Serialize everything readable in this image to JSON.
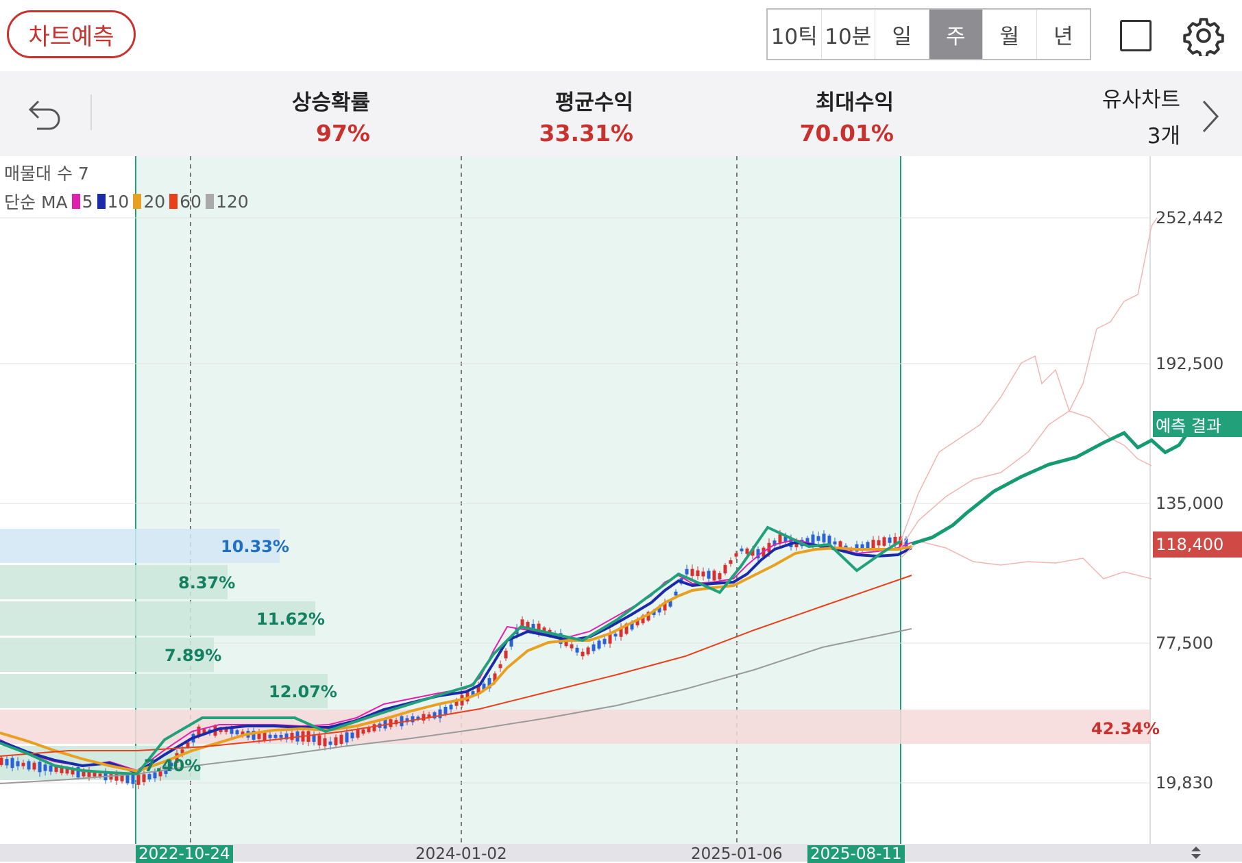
{
  "toolbar": {
    "predict_label": "차트예측",
    "periods": [
      "10틱",
      "10분",
      "일",
      "주",
      "월",
      "년"
    ],
    "active_period": "주"
  },
  "stats": {
    "rise_prob": {
      "label": "상승확률",
      "value": "97%"
    },
    "avg_return": {
      "label": "평균수익",
      "value": "33.31%"
    },
    "max_return": {
      "label": "최대수익",
      "value": "70.01%"
    },
    "similar": {
      "label": "유사차트",
      "value": "3개"
    }
  },
  "legend": {
    "volume_profile": "매물대 수 7",
    "ma_prefix": "단순 MA",
    "ma_periods": [
      {
        "period": "5",
        "color": "#e020b0"
      },
      {
        "period": "10",
        "color": "#1a2aa8"
      },
      {
        "period": "20",
        "color": "#e8a020"
      },
      {
        "period": "60",
        "color": "#e8401a"
      },
      {
        "period": "120",
        "color": "#aaaaaa"
      }
    ]
  },
  "chart_data": {
    "type": "line",
    "x_ticks": [
      "2022-10-24",
      "2024-01-02",
      "2025-01-06",
      "2025-08-11"
    ],
    "y_ticks": [
      "252,442",
      "192,500",
      "135,000",
      "77,500",
      "19,830"
    ],
    "current_price": "118,400",
    "prediction_label": "예측 결과",
    "volume_profile": [
      {
        "pct": "10.33%",
        "color": "#1f6fc4"
      },
      {
        "pct": "8.37%",
        "color": "#138060"
      },
      {
        "pct": "11.62%",
        "color": "#138060"
      },
      {
        "pct": "7.89%",
        "color": "#138060"
      },
      {
        "pct": "12.07%",
        "color": "#138060"
      },
      {
        "pct": "42.34%",
        "color": "#c8322e"
      },
      {
        "pct": "7.40%",
        "color": "#138060"
      }
    ],
    "series": [
      {
        "name": "history",
        "points": [
          [
            0,
            28800
          ],
          [
            80,
            25500
          ],
          [
            160,
            22400
          ],
          [
            200,
            21000
          ],
          [
            240,
            24000
          ],
          [
            290,
            41000
          ],
          [
            330,
            41500
          ],
          [
            380,
            39000
          ],
          [
            450,
            39000
          ],
          [
            480,
            36000
          ],
          [
            560,
            44000
          ],
          [
            640,
            48000
          ],
          [
            720,
            62000
          ],
          [
            760,
            86000
          ],
          [
            810,
            81000
          ],
          [
            850,
            73000
          ],
          [
            930,
            86000
          ],
          [
            980,
            94000
          ],
          [
            1000,
            107000
          ],
          [
            1050,
            105000
          ],
          [
            1080,
            116000
          ],
          [
            1110,
            114000
          ],
          [
            1140,
            121000
          ],
          [
            1160,
            118000
          ],
          [
            1200,
            121000
          ],
          [
            1240,
            116000
          ],
          [
            1300,
            120000
          ],
          [
            1330,
            118400
          ]
        ]
      },
      {
        "name": "prediction",
        "points": [
          [
            1330,
            118400
          ],
          [
            1360,
            121000
          ],
          [
            1390,
            126000
          ],
          [
            1410,
            131000
          ],
          [
            1450,
            140000
          ],
          [
            1490,
            146000
          ],
          [
            1530,
            151000
          ],
          [
            1570,
            154000
          ],
          [
            1610,
            160000
          ],
          [
            1640,
            164000
          ],
          [
            1660,
            158000
          ],
          [
            1680,
            161000
          ],
          [
            1700,
            156000
          ],
          [
            1720,
            159000
          ],
          [
            1748,
            170000
          ]
        ]
      },
      {
        "name": "ma60",
        "points": [
          [
            0,
            23000
          ],
          [
            200,
            22000
          ],
          [
            400,
            26000
          ],
          [
            600,
            33000
          ],
          [
            800,
            43000
          ],
          [
            1000,
            55000
          ],
          [
            1100,
            65000
          ],
          [
            1200,
            79000
          ],
          [
            1330,
            92000
          ]
        ]
      },
      {
        "name": "ma120",
        "points": [
          [
            0,
            20800
          ],
          [
            300,
            22800
          ],
          [
            500,
            27000
          ],
          [
            700,
            33000
          ],
          [
            900,
            38000
          ],
          [
            1100,
            47000
          ],
          [
            1200,
            55000
          ],
          [
            1330,
            62000
          ]
        ]
      }
    ]
  }
}
